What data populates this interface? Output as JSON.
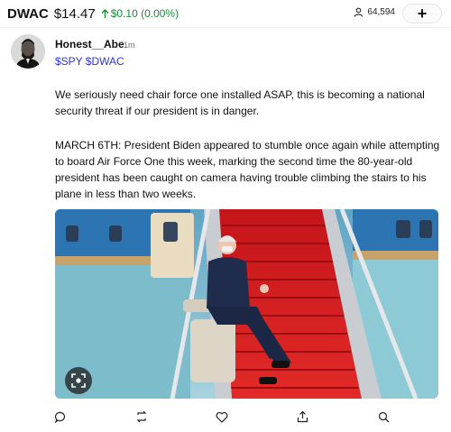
{
  "header": {
    "ticker": "DWAC",
    "price": "$14.47",
    "change": "$0.10 (0.00%)",
    "followers": "64,594",
    "plus_label": "+",
    "up_color": "#1a8a3a"
  },
  "post": {
    "username": "Honest__Abe",
    "time": "1m",
    "cashtags": "$SPY $DWAC",
    "paragraph1": "We seriously need chair force one installed ASAP, this is becoming a national security threat if our president is in danger.",
    "paragraph2": "MARCH 6TH:  President Biden appeared to stumble once again while attempting to board Air Force One this week, marking the second time the 80-year-old president has been caught on camera having trouble climbing the stairs to his plane in less than two weeks.",
    "link_color": "#2f35d6"
  },
  "actions": {
    "icons": [
      "comment-icon",
      "repost-icon",
      "like-icon",
      "share-icon",
      "search-icon"
    ]
  }
}
